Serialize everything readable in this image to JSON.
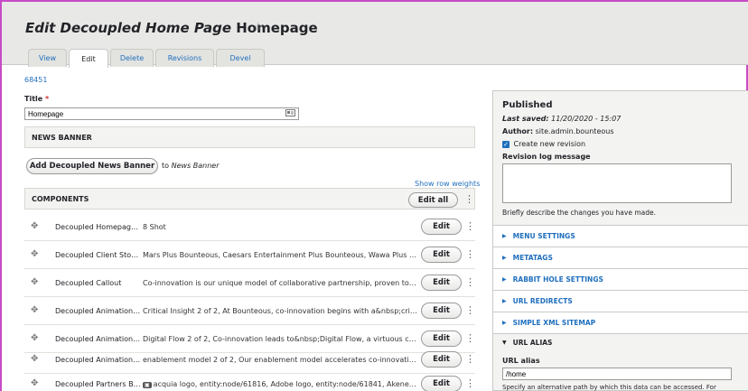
{
  "header": {
    "title_prefix": "Edit",
    "title_italic": "Decoupled Home Page",
    "title_suffix": "Homepage",
    "star_icon": "☆"
  },
  "tabs": [
    {
      "label": "View",
      "active": false
    },
    {
      "label": "Edit",
      "active": true
    },
    {
      "label": "Delete",
      "active": false
    },
    {
      "label": "Revisions",
      "active": false
    },
    {
      "label": "Devel",
      "active": false
    }
  ],
  "node_id": "68451",
  "title_field": {
    "label": "Title",
    "required_mark": "*",
    "value": "Homepage"
  },
  "news_banner": {
    "heading": "NEWS BANNER",
    "add_button": "Add Decoupled News Banner",
    "to_text": "to",
    "to_target": "News Banner"
  },
  "components": {
    "show_row_weights": "Show row weights",
    "heading": "COMPONENTS",
    "edit_all": "Edit all",
    "rows": [
      {
        "title": "Decoupled Homepag…",
        "summary": "8 Shot",
        "has_image": false,
        "edit": "Edit"
      },
      {
        "title": "Decoupled Client Sto…",
        "summary": "Mars Plus Bounteous, Caesars Entertainment Plus Bounteous, Wawa Plus Bount…",
        "has_image": false,
        "edit": "Edit"
      },
      {
        "title": "Decoupled Callout",
        "summary": "Co-innovation is our unique model of collaborative partnership, proven to hel…",
        "has_image": false,
        "edit": "Edit"
      },
      {
        "title": "Decoupled Animation…",
        "summary": "Critical Insight 2 of 2, At Bounteous, co-innovation begins with a&nbsp;critica…",
        "has_image": false,
        "edit": "Edit"
      },
      {
        "title": "Decoupled Animation…",
        "summary": "Digital Flow 2 of 2, Co-innovation leads to&nbsp;Digital Flow, a virtuous cycle…",
        "has_image": false,
        "edit": "Edit"
      },
      {
        "title": "Decoupled Animation…",
        "summary": "enablement model 2 of 2, Our enablement model accelerates co-innovation a…",
        "has_image": false,
        "edit": "Edit"
      },
      {
        "title": "Decoupled Partners B…",
        "summary": "acquia logo, entity:node/61816, Adobe logo, entity:node/61841, Akeneo lo…",
        "has_image": true,
        "edit": "Edit"
      }
    ]
  },
  "sidebar": {
    "status": "Published",
    "last_saved_label": "Last saved:",
    "last_saved_value": "11/20/2020 - 15:07",
    "author_label": "Author:",
    "author_value": "site.admin.bounteous",
    "create_revision": "Create new revision",
    "revision_log_label": "Revision log message",
    "revision_help": "Briefly describe the changes you have made.",
    "sections": [
      {
        "label": "MENU SETTINGS",
        "open": false
      },
      {
        "label": "METATAGS",
        "open": false
      },
      {
        "label": "RABBIT HOLE SETTINGS",
        "open": false
      },
      {
        "label": "URL REDIRECTS",
        "open": false
      },
      {
        "label": "SIMPLE XML SITEMAP",
        "open": false
      },
      {
        "label": "URL ALIAS",
        "open": true
      }
    ],
    "url_alias_label": "URL alias",
    "url_alias_value": "/home",
    "url_alias_help": "Specify an alternative path by which this data can be accessed. For"
  },
  "icons": {
    "drag": "drag-handle-icon",
    "kebab": "kebab-menu-icon",
    "image": "image-icon",
    "card": "id-card-icon",
    "collapsed": "triangle-right-icon",
    "expanded": "triangle-down-icon"
  },
  "colors": {
    "link": "#1f6fbe",
    "required": "#d62d2d",
    "frame": "#c74bc7",
    "header_bg": "#e8e8e6"
  }
}
